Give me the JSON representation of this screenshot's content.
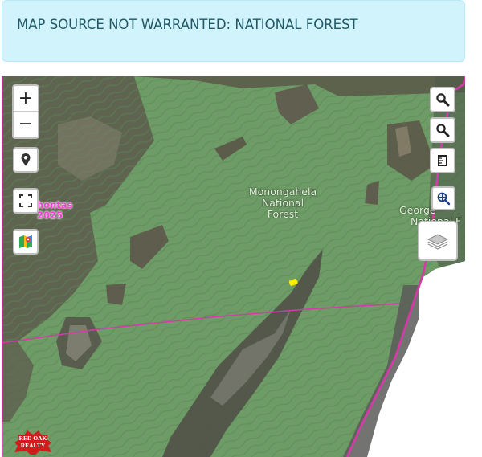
{
  "alert": {
    "text": "MAP SOURCE NOT WARRANTED: NATIONAL FOREST"
  },
  "map": {
    "labels": {
      "forest_name": [
        "Monongahela",
        "National",
        "Forest"
      ],
      "george": [
        "George",
        "National F"
      ],
      "county_name": "hontas",
      "county_year": "2025"
    },
    "controls": {
      "zoom_in": "+",
      "zoom_out": "−"
    },
    "watermark": {
      "line1": "RED OAK",
      "line2": "REALTY"
    },
    "colors": {
      "boundary": "#d63aa8",
      "forest": "#6e9c67",
      "marker": "#ffee00"
    }
  }
}
